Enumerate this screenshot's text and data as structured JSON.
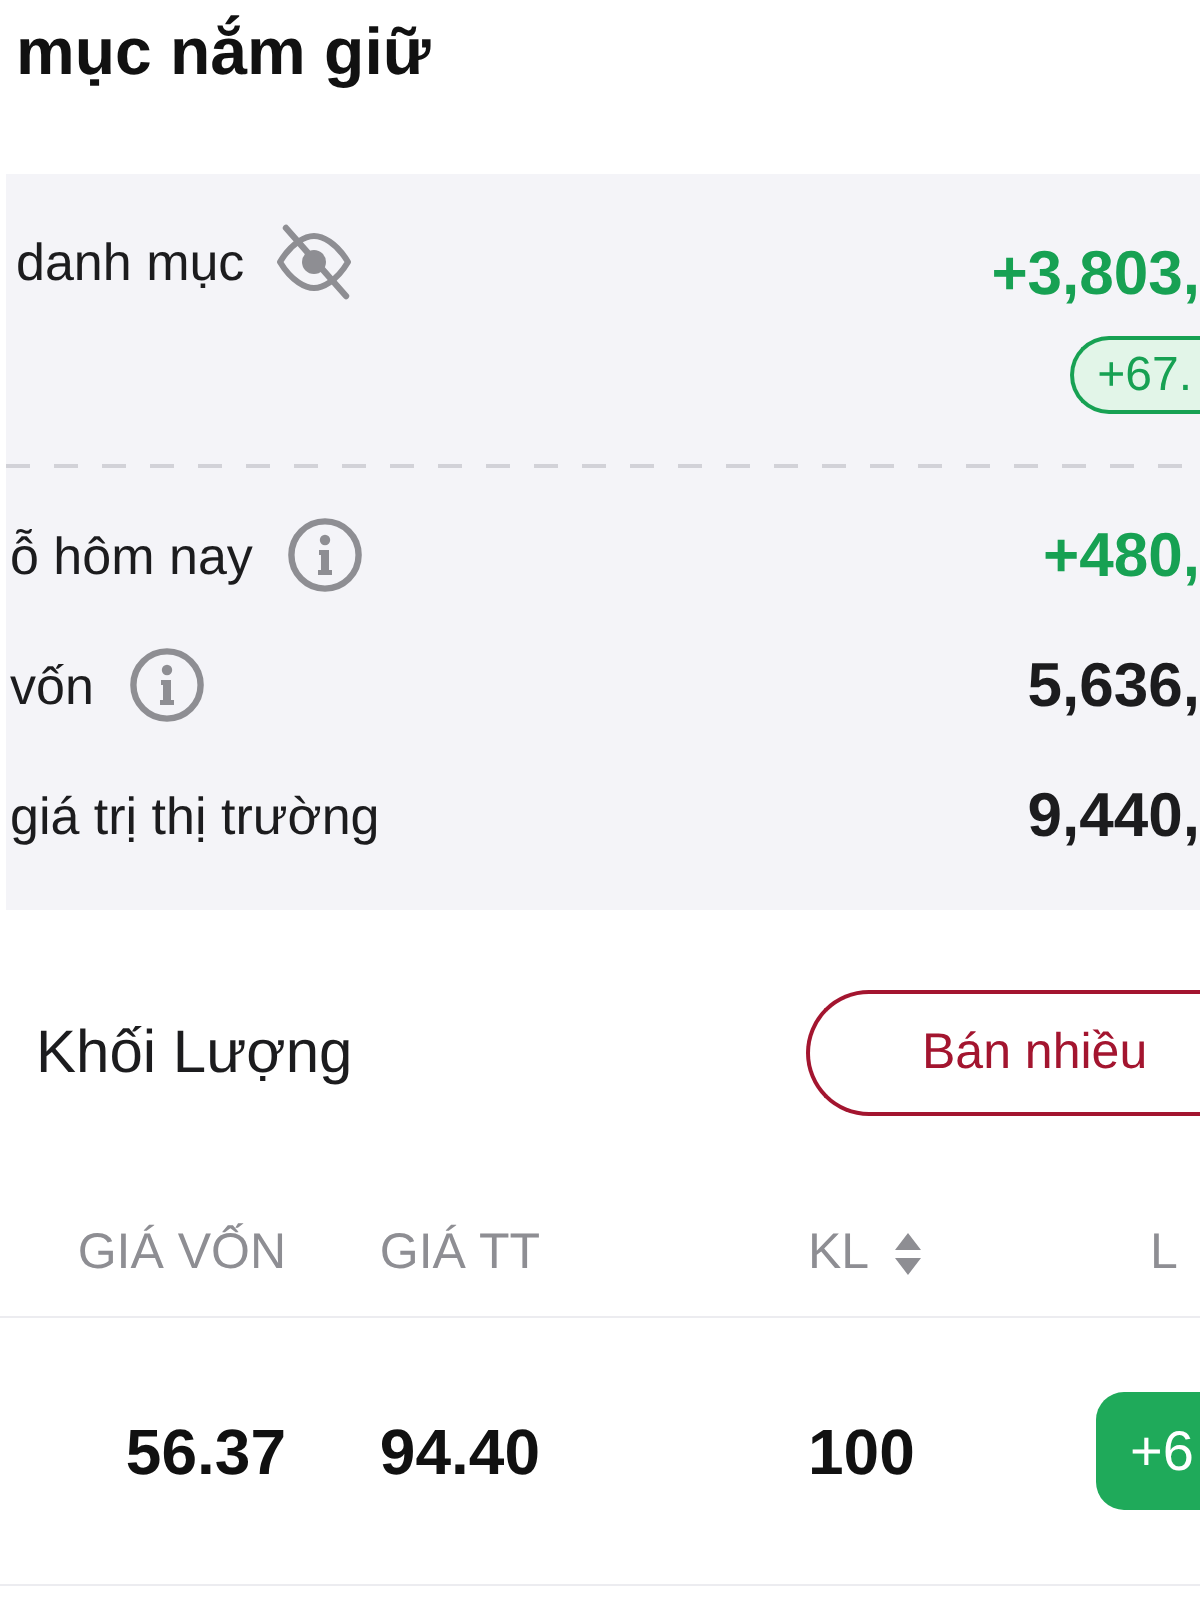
{
  "page": {
    "title": "mục nắm giữ"
  },
  "portfolio": {
    "label": "danh mục",
    "value": "+3,803,",
    "change": "+67."
  },
  "stats": [
    {
      "label": "ỗ hôm nay",
      "info": true,
      "value": "+480,",
      "color": "#17a153"
    },
    {
      "label": "vốn",
      "info": true,
      "value": "5,636,",
      "color": "#1c1c1e"
    },
    {
      "label": "giá trị thị trường",
      "info": false,
      "value": "9,440,",
      "color": "#1c1c1e"
    }
  ],
  "toolbar": {
    "sort_label": "Khối Lượng",
    "sell_button": "Bán nhiều"
  },
  "table": {
    "columns": [
      {
        "label": "GIÁ VỐN",
        "sortable": false
      },
      {
        "label": "GIÁ TT",
        "sortable": false
      },
      {
        "label": "KL",
        "sortable": true
      },
      {
        "label": "L",
        "sortable": false
      }
    ],
    "rows": [
      {
        "cells": [
          "56.37",
          "94.40",
          "100"
        ],
        "change": "+6"
      }
    ]
  }
}
